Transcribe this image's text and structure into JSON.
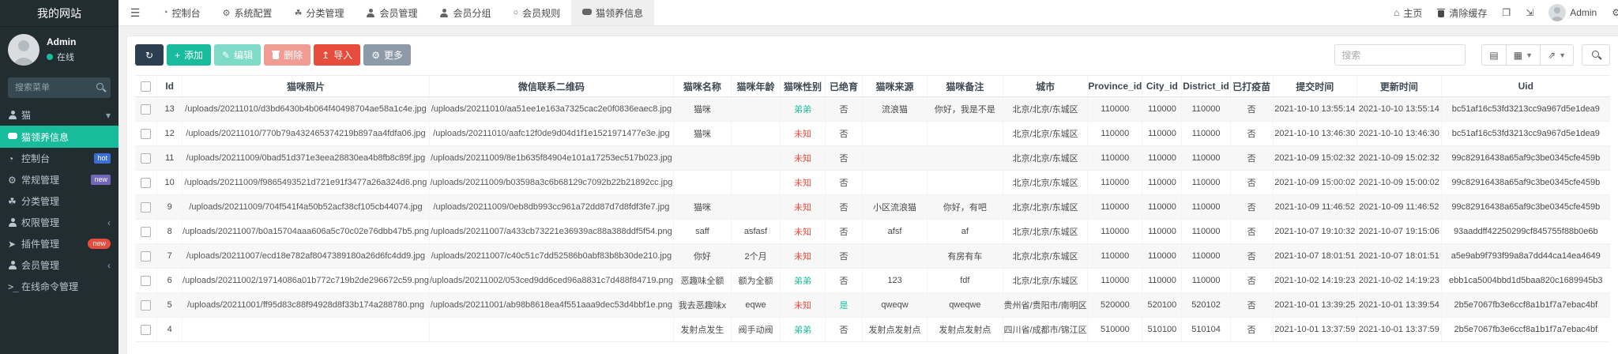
{
  "colors": {
    "accent_teal": "#18bc9c",
    "danger_red": "#e74c3c",
    "dark_navy": "#2c3e50",
    "more_gray": "#8d9aa8",
    "hot_blue": "#3b6fd6",
    "new_purple": "#7266ba",
    "sidebar_bg": "#222d32"
  },
  "sidebar": {
    "title": "我的网站",
    "user": {
      "name": "Admin",
      "status": "在线"
    },
    "search_placeholder": "搜索菜单",
    "items": [
      {
        "key": "cat",
        "label": "猫",
        "icon": "users-icon",
        "chevron": "down"
      },
      {
        "key": "cat-adoption",
        "label": "猫领养信息",
        "icon": "comment-icon",
        "active": true
      },
      {
        "key": "dashboard",
        "label": "控制台",
        "icon": "dashboard-icon",
        "badge": "hot",
        "badge_color": "#3b6fd6"
      },
      {
        "key": "general",
        "label": "常规管理",
        "icon": "gears-icon",
        "badge": "new",
        "badge_color": "#7266ba"
      },
      {
        "key": "category",
        "label": "分类管理",
        "icon": "leaf-icon"
      },
      {
        "key": "auth",
        "label": "权限管理",
        "icon": "users-icon",
        "chevron": "left"
      },
      {
        "key": "addon",
        "label": "插件管理",
        "icon": "send-icon",
        "badge": "new",
        "badge_color": "#e74c3c",
        "badge_pill": true
      },
      {
        "key": "member",
        "label": "会员管理",
        "icon": "user-icon",
        "chevron": "left"
      },
      {
        "key": "command",
        "label": "在线命令管理",
        "icon": "terminal-icon"
      }
    ]
  },
  "topbar": {
    "tabs": [
      {
        "key": "dashboard",
        "label": "控制台",
        "icon": "dashboard-icon"
      },
      {
        "key": "system-config",
        "label": "系统配置",
        "icon": "gear-icon"
      },
      {
        "key": "category",
        "label": "分类管理",
        "icon": "leaf-icon"
      },
      {
        "key": "member",
        "label": "会员管理",
        "icon": "user-icon"
      },
      {
        "key": "member-group",
        "label": "会员分组",
        "icon": "users-icon"
      },
      {
        "key": "member-rule",
        "label": "会员规则",
        "icon": "circle-icon"
      },
      {
        "key": "cat-adoption",
        "label": "猫领养信息",
        "icon": "comment-icon",
        "active": true
      }
    ],
    "right": {
      "home_label": "主页",
      "clear_cache_label": "清除缓存",
      "user_name": "Admin"
    }
  },
  "toolbar": {
    "buttons": [
      {
        "key": "refresh",
        "label": "",
        "icon": "refresh-icon",
        "bg": "#2c3e50"
      },
      {
        "key": "add",
        "label": "添加",
        "icon": "plus-icon",
        "bg": "#18bc9c"
      },
      {
        "key": "edit",
        "label": "编辑",
        "icon": "pencil-icon",
        "bg": "#18bc9c",
        "disabled": true
      },
      {
        "key": "delete",
        "label": "删除",
        "icon": "trash-icon",
        "bg": "#e74c3c",
        "disabled": true
      },
      {
        "key": "import",
        "label": "导入",
        "icon": "upload-icon",
        "bg": "#e74c3c"
      },
      {
        "key": "more",
        "label": "更多",
        "icon": "gear-icon",
        "bg": "#8d9aa8"
      }
    ],
    "search_placeholder": "搜索"
  },
  "table": {
    "columns": [
      "Id",
      "猫咪照片",
      "微信联系二维码",
      "猫咪名称",
      "猫咪年龄",
      "猫咪性别",
      "已绝育",
      "猫咪来源",
      "猫咪备注",
      "城市",
      "Province_id",
      "City_id",
      "District_id",
      "已打疫苗",
      "提交时间",
      "更新时间",
      "Uid"
    ],
    "rows": [
      [
        "13",
        "/uploads/20211010/d3bd6430b4b064f40498704ae58a1c4e.jpg",
        "/uploads/20211010/aa51ee1e163a7325cac2e0f0836eaec8.jpg",
        "猫咪",
        "",
        "弟弟",
        "否",
        "流浪猫",
        "你好，我是不是",
        "北京/北京/东城区",
        "110000",
        "110000",
        "110000",
        "否",
        "2021-10-10 13:55:14",
        "2021-10-10 13:55:14",
        "bc51af16c53fd3213cc9a967d5e1dea9"
      ],
      [
        "12",
        "/uploads/20211010/770b79a432465374219b897aa4fdfa06.jpg",
        "/uploads/20211010/aafc12f0de9d04d1f1e1521971477e3e.jpg",
        "猫咪",
        "",
        "未知",
        "否",
        "",
        "",
        "北京/北京/东城区",
        "110000",
        "110000",
        "110000",
        "否",
        "2021-10-10 13:46:30",
        "2021-10-10 13:46:30",
        "bc51af16c53fd3213cc9a967d5e1dea9"
      ],
      [
        "11",
        "/uploads/20211009/0bad51d371e3eea28830ea4b8fb8c89f.jpg",
        "/uploads/20211009/8e1b635f84904e101a17253ec517b023.jpg",
        "",
        "",
        "未知",
        "否",
        "",
        "",
        "北京/北京/东城区",
        "110000",
        "110000",
        "110000",
        "否",
        "2021-10-09 15:02:32",
        "2021-10-09 15:02:32",
        "99c82916438a65af9c3be0345cfe459b"
      ],
      [
        "10",
        "/uploads/20211009/f9865493521d721e91f3477a26a324d6.png",
        "/uploads/20211009/b03598a3c6b68129c7092b22b21892cc.jpg",
        "",
        "",
        "未知",
        "否",
        "",
        "",
        "北京/北京/东城区",
        "110000",
        "110000",
        "110000",
        "否",
        "2021-10-09 15:00:02",
        "2021-10-09 15:00:02",
        "99c82916438a65af9c3be0345cfe459b"
      ],
      [
        "9",
        "/uploads/20211009/704f541f4a50b52acf38cf105cb44074.jpg",
        "/uploads/20211009/0eb8db993cc961a72dd87d7d8fdf3fe7.jpg",
        "猫咪",
        "",
        "未知",
        "否",
        "小区流浪猫",
        "你好，有吧",
        "北京/北京/东城区",
        "110000",
        "110000",
        "110000",
        "否",
        "2021-10-09 11:46:52",
        "2021-10-09 11:46:52",
        "99c82916438a65af9c3be0345cfe459b"
      ],
      [
        "8",
        "/uploads/20211007/b0a15704aaa606a5c70c02e76dbb47b5.png",
        "/uploads/20211007/a433cb73221e36939ac88a388ddf5f54.png",
        "saff",
        "asfasf",
        "未知",
        "否",
        "afsf",
        "af",
        "北京/北京/东城区",
        "110000",
        "110000",
        "110000",
        "否",
        "2021-10-07 19:10:32",
        "2021-10-07 19:15:06",
        "93aaddff42250299cf845755f88b0e6b"
      ],
      [
        "7",
        "/uploads/20211007/ecd18e782af8047389180a26d6fc4dd9.jpg",
        "/uploads/20211007/c40c51c7dd52586b0abf83b8b30de210.jpg",
        "你好",
        "2个月",
        "未知",
        "否",
        "",
        "有房有车",
        "北京/北京/东城区",
        "110000",
        "110000",
        "110000",
        "否",
        "2021-10-07 18:01:51",
        "2021-10-07 18:01:51",
        "a5e9ab9f793f99a8a7dd44ca14ea4649"
      ],
      [
        "6",
        "/uploads/20211002/19714086a01b772c719b2de296672c59.png",
        "/uploads/20211002/053ced9dd6ced96a8831c7d488f84719.png",
        "恶趣味全额",
        "额为全额",
        "弟弟",
        "否",
        "123",
        "fdf",
        "北京/北京/东城区",
        "110000",
        "110000",
        "110000",
        "否",
        "2021-10-02 14:19:23",
        "2021-10-02 14:19:23",
        "ebb1ca5004bbd1d5baa820c1689945b3"
      ],
      [
        "5",
        "/uploads/20211001/ff95d83c88f94928d8f33b174a288780.png",
        "/uploads/20211001/ab98b8618ea4f551aaa9dec53d4bbf1e.png",
        "我去恶趣味x",
        "eqwe",
        "未知",
        "是",
        "qweqw",
        "qweqwe",
        "贵州省/贵阳市/南明区",
        "520000",
        "520100",
        "520102",
        "否",
        "2021-10-01 13:39:25",
        "2021-10-01 13:39:54",
        "2b5e7067fb3e6ccf8a1b1f7a7ebac4bf"
      ],
      [
        "4",
        "",
        "",
        "发射点发生",
        "阀手动阀",
        "弟弟",
        "否",
        "发射点发射点",
        "发射点发射点",
        "四川省/成都市/锦江区",
        "510000",
        "510100",
        "510104",
        "否",
        "2021-10-01 13:37:59",
        "2021-10-01 13:37:59",
        "2b5e7067fb3e6ccf8a1b1f7a7ebac4bf"
      ]
    ]
  }
}
